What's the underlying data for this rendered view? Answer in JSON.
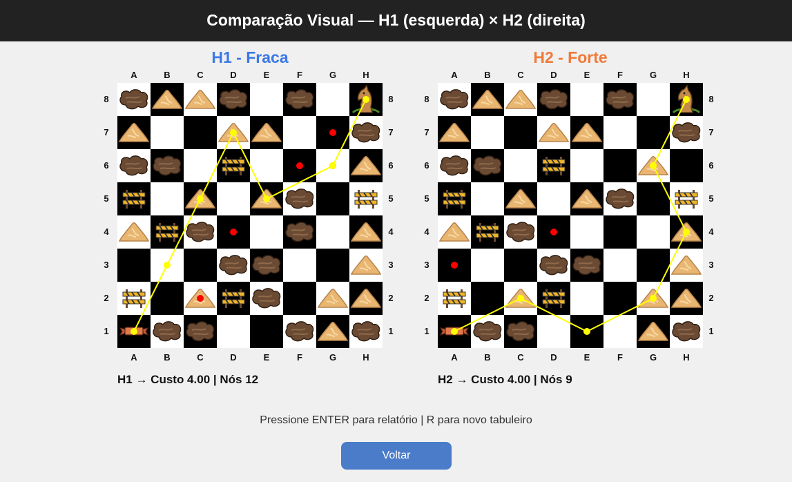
{
  "header": {
    "title": "Comparação Visual — H1 (esquerda) × H2 (direita)"
  },
  "colors": {
    "h1_title": "#3b78e7",
    "h2_title": "#f07a3a",
    "path": "#ffff00",
    "marker": "#ff0000",
    "button": "#4a7cc9"
  },
  "files": [
    "A",
    "B",
    "C",
    "D",
    "E",
    "F",
    "G",
    "H"
  ],
  "ranks": [
    "8",
    "7",
    "6",
    "5",
    "4",
    "3",
    "2",
    "1"
  ],
  "legend_icons": {
    "W": "mud-icon",
    "S": "sand-icon",
    "B": "barrier-icon",
    "K": "knight-icon",
    "T": "start-banner-icon",
    "M": "marker-dot"
  },
  "boards": [
    {
      "id": "h1",
      "title": "H1 - Fraca",
      "stats": "H1 → Custo 4.00 | Nós 12",
      "grid": [
        "WSSW.W.K",
        "S..SS.MW",
        "WW.B.MMS",
        "B.S.SW.B",
        "SBWM.W.S",
        "...WW..S",
        "B.SBW.SS",
        "TWW..WSW"
      ],
      "path": [
        "A1",
        "B3",
        "C5",
        "D7",
        "E5",
        "G6",
        "H8"
      ],
      "path_markers": [
        "C2"
      ]
    },
    {
      "id": "h2",
      "title": "H2 - Forte",
      "stats": "H2 → Custo 4.00 | Nós 9",
      "grid": [
        "WSSW.W.K",
        "S..SS..W",
        "WW.B..S.",
        "B.S.SW.B",
        "SBWM...S",
        "M..WW..S",
        "B.SB..SS",
        "TWW...SW"
      ],
      "path": [
        "A1",
        "C2",
        "E1",
        "G2",
        "H4",
        "G6",
        "H8"
      ],
      "path_markers": []
    }
  ],
  "footer": {
    "hint": "Pressione ENTER para relatório | R para novo tabuleiro",
    "button_label": "Voltar"
  }
}
